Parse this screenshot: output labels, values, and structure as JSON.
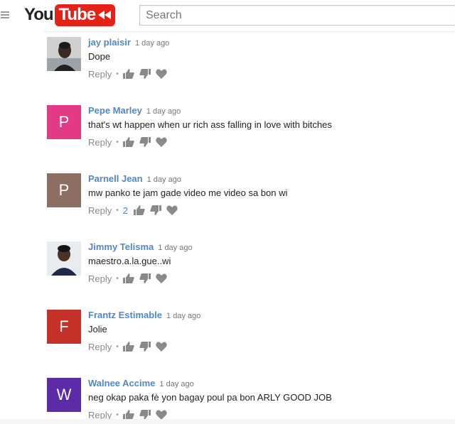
{
  "header": {
    "logo_you": "You",
    "logo_tube": "Tube",
    "search_placeholder": "Search"
  },
  "comments": [
    {
      "author": "jay plaisir",
      "time": "1 day ago",
      "text": "Dope",
      "reply": "Reply",
      "avatar_type": "photo"
    },
    {
      "author": "Pepe Marley",
      "time": "1 day ago",
      "text": "that's wt happen when ur rich ass falling in love with bitches",
      "reply": "Reply",
      "avatar_letter": "P",
      "avatar_color": "#e33a86"
    },
    {
      "author": "Parnell Jean",
      "time": "1 day ago",
      "text": "mw panko te jam gade video me video sa bon wi",
      "reply": "Reply",
      "reply_count": "2",
      "avatar_letter": "P",
      "avatar_color": "#8d6e63"
    },
    {
      "author": "Jimmy Telisma",
      "time": "1 day ago",
      "text": "maestro.a.la.gue..wi",
      "reply": "Reply",
      "avatar_type": "photo"
    },
    {
      "author": "Frantz Estimable",
      "time": "1 day ago",
      "text": "Jolie",
      "reply": "Reply",
      "avatar_letter": "F",
      "avatar_color": "#c6322a"
    },
    {
      "author": "Walnee Accime",
      "time": "1 day ago",
      "text": "neg okap paka fè yon bagay poul pa bon ARLY GOOD JOB",
      "reply": "Reply",
      "avatar_letter": "W",
      "avatar_color": "#5e2ba6"
    }
  ],
  "icons": {
    "like": "thumbs-up-icon",
    "dislike": "thumbs-down-icon",
    "heart": "heart-icon"
  }
}
